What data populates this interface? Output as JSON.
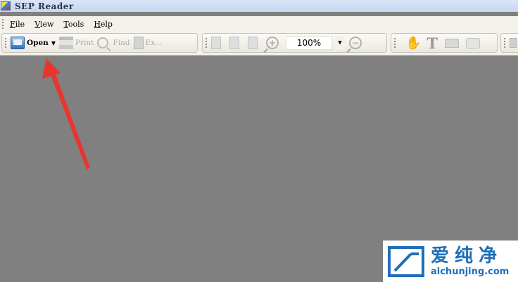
{
  "window": {
    "title": "SEP Reader"
  },
  "menu": {
    "items": [
      {
        "mnemonic": "F",
        "rest": "ile"
      },
      {
        "mnemonic": "V",
        "rest": "iew"
      },
      {
        "mnemonic": "T",
        "rest": "ools"
      },
      {
        "mnemonic": "H",
        "rest": "elp"
      }
    ]
  },
  "toolbar": {
    "open_label": "Open",
    "print_label": "Print",
    "find_label": "Find",
    "export_label": "Ex...",
    "zoom_value": "100%"
  },
  "annotation": {
    "color": "#e8352e"
  },
  "watermark": {
    "name": "爱纯净",
    "url": "aichunjing.com"
  }
}
